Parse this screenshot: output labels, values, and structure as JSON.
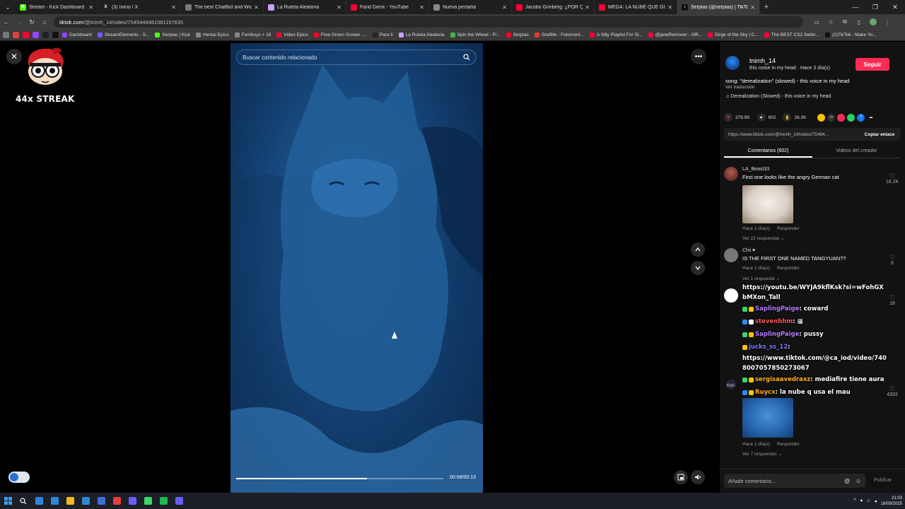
{
  "browser": {
    "tabs": [
      {
        "label": "Stream - Kick Dashboard",
        "color": "#53fc18",
        "glyph": "K",
        "active": false
      },
      {
        "label": "(3) Inicio / X",
        "color": "#222222",
        "glyph": "X",
        "active": false
      },
      {
        "label": "The best ChatBot and Widgets",
        "color": "#7a7a7a",
        "glyph": "",
        "active": false
      },
      {
        "label": "La Ruleta Aleatoria",
        "color": "#c9a0ff",
        "glyph": "",
        "active": false
      },
      {
        "label": "Farid Dieck - YouTube",
        "color": "#ff0033",
        "glyph": "",
        "active": false
      },
      {
        "label": "Nueva pestaña",
        "color": "#888888",
        "glyph": "",
        "active": false
      },
      {
        "label": "Jacobo Grinberg: ¿POR QUÉ DI",
        "color": "#ff0033",
        "glyph": "",
        "active": false
      },
      {
        "label": "MEGA: LA NUBE QUE GUARDA",
        "color": "#ff0033",
        "glyph": "",
        "active": false
      },
      {
        "label": "Serpias (@serpias) | TikTok",
        "color": "#111111",
        "glyph": "♪",
        "active": true
      }
    ],
    "new_tab": "+",
    "window_controls": [
      "—",
      "❐",
      "✕"
    ],
    "url_host": "tiktok.com",
    "url_path": "/@tnimh_14/video/7549448481581157635",
    "bookmarks": [
      {
        "label": "Dashboard",
        "color": "#9146ff"
      },
      {
        "label": "StreamElements - S...",
        "color": "#6b5cff"
      },
      {
        "label": "Serpias | Kick",
        "color": "#53fc18"
      },
      {
        "label": "Hentai Epico",
        "color": "#888888"
      },
      {
        "label": "Femboys + 18",
        "color": "#888888"
      },
      {
        "label": "Video Epico",
        "color": "#ff0033"
      },
      {
        "label": "Free Green Screen -...",
        "color": "#ff0033"
      },
      {
        "label": "Para ti",
        "color": "#222222"
      },
      {
        "label": "La Ruleta Aleatoria",
        "color": "#c9a0ff"
      },
      {
        "label": "Spin the Wheel - Fr...",
        "color": "#4caf50"
      },
      {
        "label": "Serpias",
        "color": "#ff0033"
      },
      {
        "label": "GrafMe - Fotomont...",
        "color": "#e53935"
      },
      {
        "label": "A Silly Playlist For Si...",
        "color": "#ff0033"
      },
      {
        "label": "@janeRemover - Offi...",
        "color": "#ff0033"
      },
      {
        "label": "Dirge of the Sky | C...",
        "color": "#ff0033"
      },
      {
        "label": "The BEST CS2 Settin...",
        "color": "#ff0033"
      },
      {
        "label": "(2)TikTok - Make Yo...",
        "color": "#111111"
      }
    ]
  },
  "overlay_streak": {
    "label": "44x STREAK"
  },
  "video": {
    "search_placeholder": "Buscar contenido relacionado",
    "progress": 0.63,
    "timecode": "00:08/00:13"
  },
  "panel": {
    "username": "tnimh_14",
    "meta": "this noise in my head · Hace 3 día(s)",
    "follow_label": "Seguir",
    "description": "song: \"derealization\" (slowed) - this voice in my head",
    "translate": "Ver traducción",
    "music": "♫  Derealization (Slowed) - this voice in my head",
    "stats": {
      "likes": "379.5K",
      "comments": "602",
      "saves": "26.3K"
    },
    "link": "https://www.tiktok.com/@tnimh_14/video/75494...",
    "copy_label": "Copiar enlace",
    "tabs": [
      "Comentarios (602)",
      "Videos del creador"
    ],
    "comments": [
      {
        "user": "LA_Beast33",
        "text": "First one looks like the angry German cat",
        "meta": "Hace 1 día(s)",
        "reply": "Responder",
        "replies": "Ver 22 respuestas ⌄",
        "likes": "16.2K"
      },
      {
        "user": "Chii ♥",
        "text": "IS THE FIRST ONE NAMED TANGYUAN??",
        "meta": "Hace 1 día(s)",
        "reply": "Responder",
        "replies": "Ver 1 respuesta ⌄",
        "likes": "6"
      },
      {
        "user": "",
        "text": "",
        "meta": "",
        "reply": "",
        "replies": "",
        "likes": "18"
      },
      {
        "user": "Kori",
        "text": "",
        "meta": "Hace 1 día(s)",
        "reply": "Responder",
        "replies": "Ver 7 respuestas ⌄",
        "likes": "4393"
      }
    ],
    "comment_placeholder": "Añadir comentario...",
    "publish_label": "Publicar"
  },
  "chat_overlay": [
    {
      "user": "",
      "msg": "https://youtu.be/WYJA9kflKsk?si=wFohGXbMXon_Tall",
      "color": "#ffffff"
    },
    {
      "user": "SaplingPaige",
      "msg": ": coward",
      "color": "#b57bff"
    },
    {
      "user": "stevenhhm",
      "msg": ": ▦",
      "color": "#ff5a5a"
    },
    {
      "user": "SaplingPaige",
      "msg": ": pussy",
      "color": "#b57bff"
    },
    {
      "user": "jucks_ss_12",
      "msg": ":",
      "color": "#7a7aff"
    },
    {
      "user": "",
      "msg": "https://www.tiktok.com/@ca_iod/video/7408007057850273067",
      "color": "#ffffff"
    },
    {
      "user": "sergisaavedraxz",
      "msg": ": mediafire tiene aura",
      "color": "#ffb020"
    },
    {
      "user": "Ruycx",
      "msg": ": la nube q usa el mau",
      "color": "#ffb020"
    }
  ],
  "taskbar": {
    "time": "21:03",
    "date": "16/09/2025",
    "apps": [
      "#2f86d6",
      "#2f86d6",
      "#f3b81c",
      "#2f86d6",
      "#3a6fd9",
      "#e04040",
      "#6b5cff",
      "#3ad66b",
      "#1db954",
      "#6b5cff"
    ]
  }
}
